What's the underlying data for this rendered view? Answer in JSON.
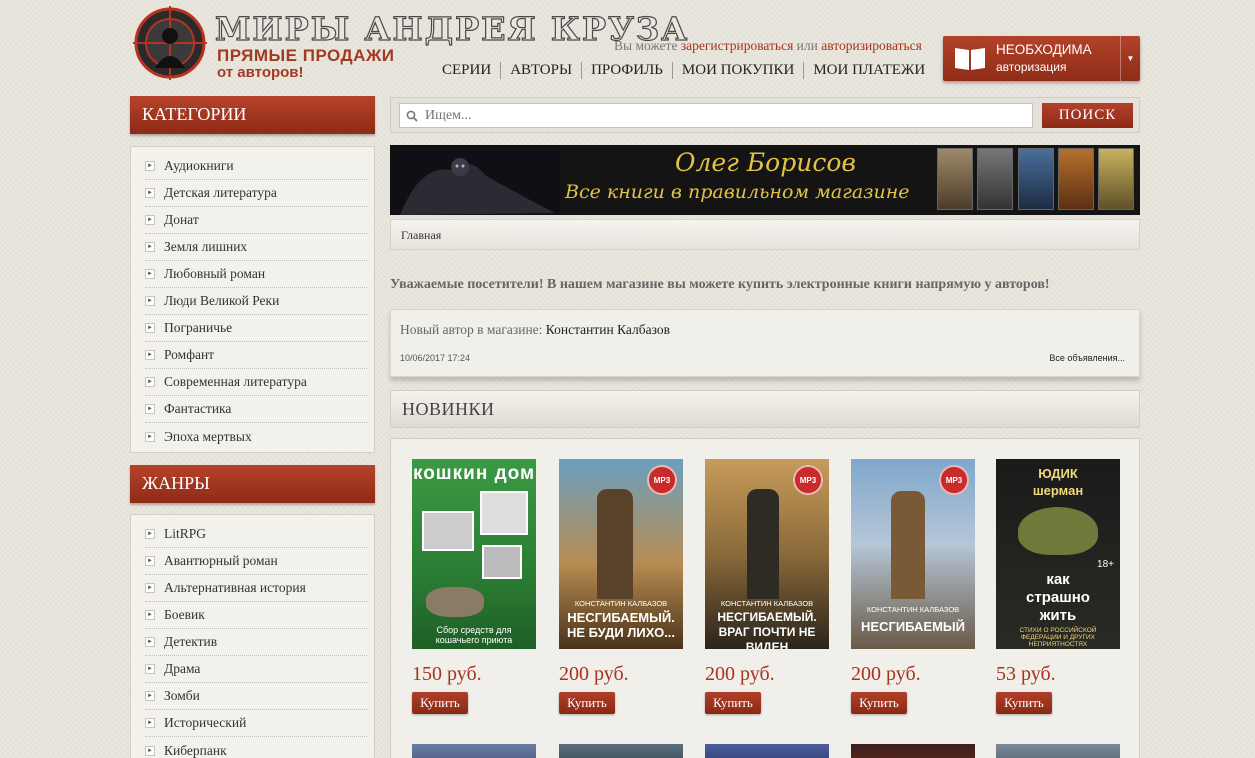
{
  "header": {
    "logo_title": "МИРЫ АНДРЕЯ КРУЗА",
    "logo_subtitle_1": "ПРЯМЫЕ ПРОДАЖИ",
    "logo_subtitle_2": "от авторов!",
    "auth_prefix": "Вы можете",
    "register_link": "зарегистрироваться",
    "auth_or": "или",
    "login_link": "авторизироваться",
    "nav": [
      "СЕРИИ",
      "АВТОРЫ",
      "ПРОФИЛЬ",
      "МОИ ПОКУПКИ",
      "МОИ ПЛАТЕЖИ"
    ],
    "auth_button_line1": "НЕОБХОДИМА",
    "auth_button_line2": "авторизация"
  },
  "sidebar": {
    "categories_title": "КАТЕГОРИИ",
    "categories": [
      "Аудиокниги",
      "Детская литература",
      "Донат",
      "Земля лишних",
      "Любовный роман",
      "Люди Великой Реки",
      "Пограничье",
      "Ромфант",
      "Современная литература",
      "Фантастика",
      "Эпоха мертвых"
    ],
    "genres_title": "ЖАНРЫ",
    "genres": [
      "LitRPG",
      "Авантюрный роман",
      "Альтернативная история",
      "Боевик",
      "Детектив",
      "Драма",
      "Зомби",
      "Исторический",
      "Киберпанк"
    ]
  },
  "search": {
    "placeholder": "Ищем...",
    "button": "ПОИСК"
  },
  "banner": {
    "name": "Олег Борисов",
    "slogan": "Все книги в правильном магазине"
  },
  "breadcrumb": "Главная",
  "welcome": "Уважаемые посетители! В нашем магазине вы можете купить электронные книги напрямую у авторов!",
  "news": {
    "prefix": "Новый автор в магазине:",
    "author": "Константин Калбазов",
    "date": "10/06/2017 17:24",
    "all_link": "Все объявления..."
  },
  "section_title": "НОВИНКИ",
  "products": [
    {
      "price": "150 руб.",
      "buy": "Купить",
      "cover_title": "кошкин дом",
      "cover_caption": "Сбор средств для кошачьего приюта",
      "mp3": ""
    },
    {
      "price": "200 руб.",
      "buy": "Купить",
      "cover_author": "КОНСТАНТИН КАЛБАЗОВ",
      "cover_title": "НЕСГИБАЕМЫЙ. НЕ БУДИ ЛИХО...",
      "mp3": "MP3"
    },
    {
      "price": "200 руб.",
      "buy": "Купить",
      "cover_author": "КОНСТАНТИН КАЛБАЗОВ",
      "cover_title": "НЕСГИБАЕМЫЙ. ВРАГ ПОЧТИ НЕ ВИДЕН",
      "mp3": "MP3"
    },
    {
      "price": "200 руб.",
      "buy": "Купить",
      "cover_author": "КОНСТАНТИН КАЛБАЗОВ",
      "cover_title": "НЕСГИБАЕМЫЙ",
      "mp3": "MP3"
    },
    {
      "price": "53 руб.",
      "buy": "Купить",
      "cover_author": "ЮДИК шерман",
      "cover_title": "как страшно жить",
      "cover_caption": "СТИХИ О РОССИЙСКОЙ ФЕДЕРАЦИИ И ДРУГИХ НЕПРИЯТНОСТЯХ",
      "age": "18+",
      "mp3": ""
    }
  ],
  "colors": {
    "accent": "#a8331c",
    "background": "#e9e6dd"
  }
}
